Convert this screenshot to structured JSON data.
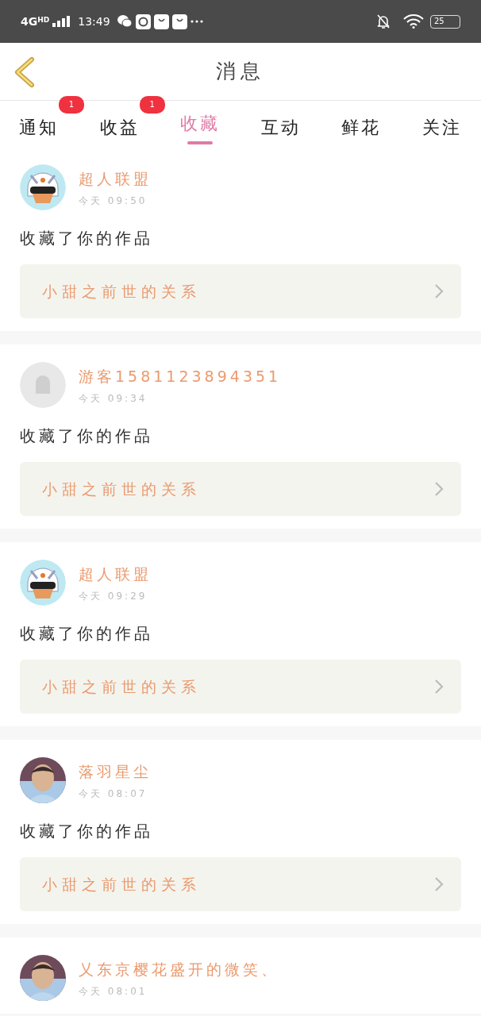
{
  "status_bar": {
    "network": "4G",
    "network_sub": "HD",
    "time": "13:49",
    "battery": "25"
  },
  "header": {
    "title": "消息"
  },
  "tabs": [
    {
      "label": "通知",
      "selected": false,
      "badge": "1"
    },
    {
      "label": "收益",
      "selected": false,
      "badge": "1"
    },
    {
      "label": "收藏",
      "selected": true
    },
    {
      "label": "互动",
      "selected": false
    },
    {
      "label": "鲜花",
      "selected": false
    },
    {
      "label": "关注",
      "selected": false
    }
  ],
  "messages": [
    {
      "kind": "cartoon",
      "name": "超人联盟",
      "time": "今天 09:50",
      "text": "收藏了你的作品",
      "work": "小甜之前世的关系"
    },
    {
      "kind": "default",
      "name": "游客1581123894351",
      "time": "今天 09:34",
      "text": "收藏了你的作品",
      "work": "小甜之前世的关系"
    },
    {
      "kind": "cartoon",
      "name": "超人联盟",
      "time": "今天 09:29",
      "text": "收藏了你的作品",
      "work": "小甜之前世的关系"
    },
    {
      "name": "落羽星尘",
      "time": "今天 08:07",
      "text": "收藏了你的作品",
      "work": "小甜之前世的关系"
    },
    {
      "name": "乂东京樱花盛开的微笑、",
      "time": "今天 08:01"
    }
  ]
}
